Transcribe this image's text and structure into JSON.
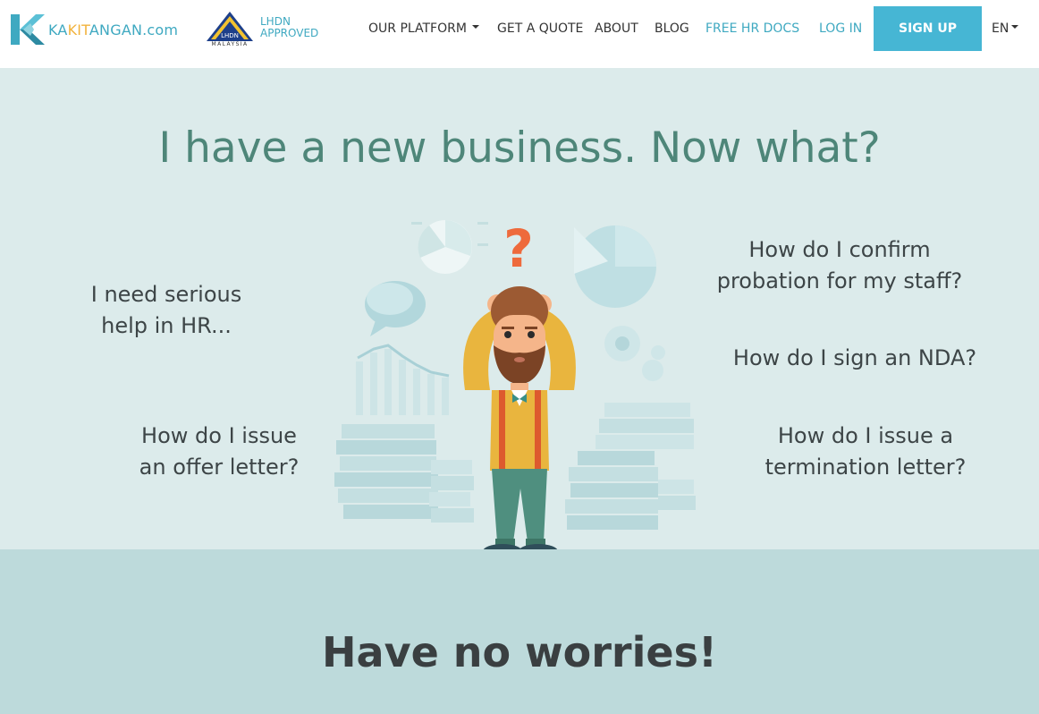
{
  "brand": {
    "name_parts": [
      "KA",
      "KIT",
      "ANGAN",
      ".com"
    ],
    "lhdn_line1": "LHDN",
    "lhdn_line2": "APPROVED",
    "lhdn_country": "MALAYSIA",
    "lhdn_emblem_text": "LHDN"
  },
  "nav": {
    "our_platform": "OUR PLATFORM",
    "get_a_quote": "GET A QUOTE",
    "about": "ABOUT",
    "blog": "BLOG",
    "free_hr_docs": "FREE HR DOCS",
    "log_in": "LOG IN",
    "sign_up": "SIGN UP",
    "language": "EN"
  },
  "hero": {
    "title": "I have a new business. Now what?",
    "questions": {
      "left_1_line1": "I need serious",
      "left_1_line2": "help in HR...",
      "left_2_line1": "How do I issue",
      "left_2_line2": "an offer letter?",
      "right_1_line1": "How do I confirm",
      "right_1_line2": "probation for my staff?",
      "right_2": "How do I sign an NDA?",
      "right_3_line1": "How do I issue a",
      "right_3_line2": "termination letter?"
    },
    "question_mark": "?"
  },
  "bottom": {
    "title": "Have no worries!"
  },
  "colors": {
    "accent": "#46b6d4",
    "hero_bg": "#dcebeb",
    "bottom_bg": "#bddadb",
    "title_green": "#4e8679",
    "question_orange": "#ee6a3c"
  }
}
